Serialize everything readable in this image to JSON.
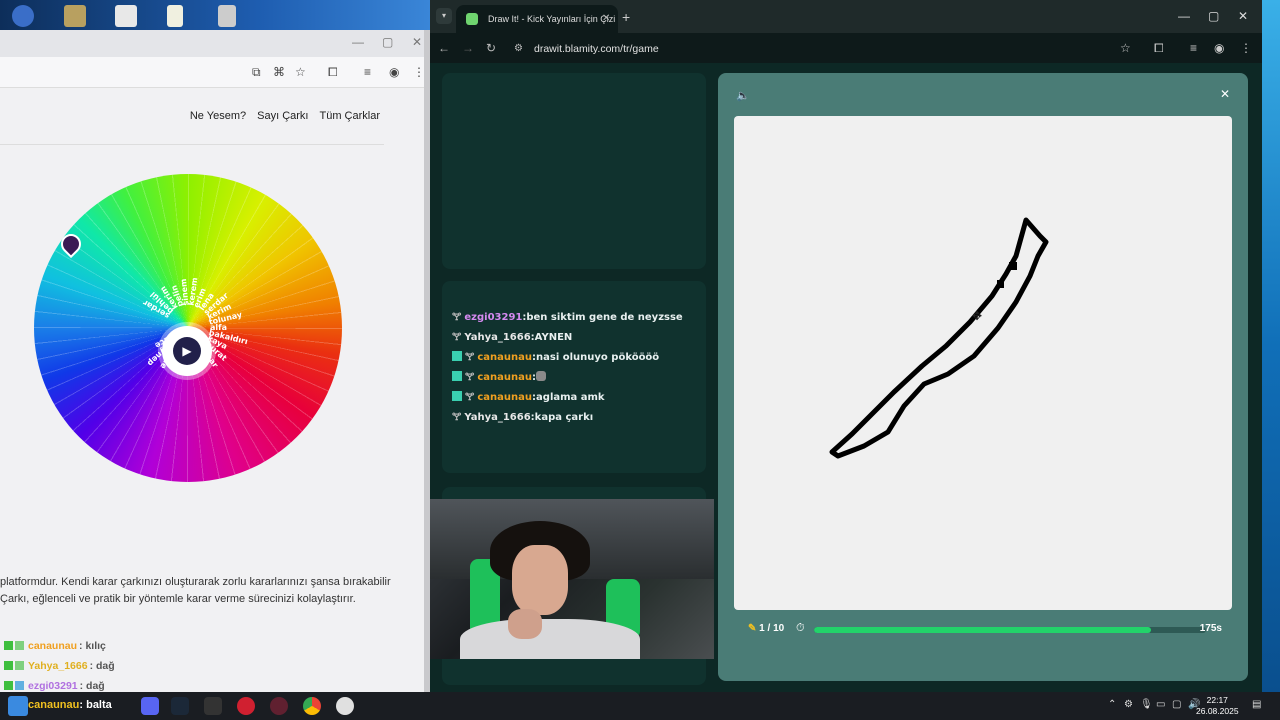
{
  "left_window": {
    "nav_items": [
      "Ne Yesem?",
      "Sayı Çarkı",
      "Tüm Çarklar"
    ],
    "wheel_labels": [
      "serdar",
      "behlül",
      "kerim",
      "pelin",
      "sinem",
      "kerem",
      "erim",
      "lena",
      "serdar",
      "kerim",
      "tolunay",
      "alfa",
      "bakaldırı",
      "kaya",
      "murat",
      "bahar",
      "eda",
      "tuna",
      "mert",
      "sefa",
      "defne",
      "zeynep",
      "ece"
    ],
    "description_line1": "platformdur. Kendi karar çarkınızı oluşturarak zorlu kararlarınızı şansa bırakabilir",
    "description_line2": "Çarkı, eğlenceli ve pratik bir yöntemle karar verme sürecinizi kolaylaştırır.",
    "chat": [
      {
        "user": "canaunau",
        "msg": "kılıç"
      },
      {
        "user": "Yahya_1666",
        "msg": "dağ"
      },
      {
        "user": "ezgi03291",
        "msg": "dağ"
      }
    ]
  },
  "right_window": {
    "tab_title": "Draw It! - Kick Yayınları İçin Çizi",
    "url": "drawit.blamity.com/tr/game",
    "chat": [
      {
        "user": "ezgi03291",
        "msg": "ben siktim gene de neyzsse",
        "color": "#d58af0",
        "badge": false
      },
      {
        "user": "Yahya_1666",
        "msg": "AYNEN",
        "color": "#e8e8e8",
        "badge": false
      },
      {
        "user": "canaunau",
        "msg": "nasi olunuyo pököööö",
        "color": "#f0a020",
        "badge": true
      },
      {
        "user": "canaunau",
        "msg": "",
        "color": "#f0a020",
        "badge": true
      },
      {
        "user": "canaunau",
        "msg": "aglama amk",
        "color": "#f0a020",
        "badge": true
      },
      {
        "user": "Yahya_1666",
        "msg": "kapa çarkı",
        "color": "#e8e8e8",
        "badge": false
      }
    ],
    "game": {
      "round": "1 / 10",
      "time": "175s",
      "progress": 0.86
    }
  },
  "taskbar": {
    "overlay_user": "canaunau",
    "overlay_msg": "balta",
    "time": "22:17",
    "date": "26.08.2025"
  },
  "colors": {
    "accent_green": "#22d36a",
    "game_bg": "#4a7c76"
  }
}
